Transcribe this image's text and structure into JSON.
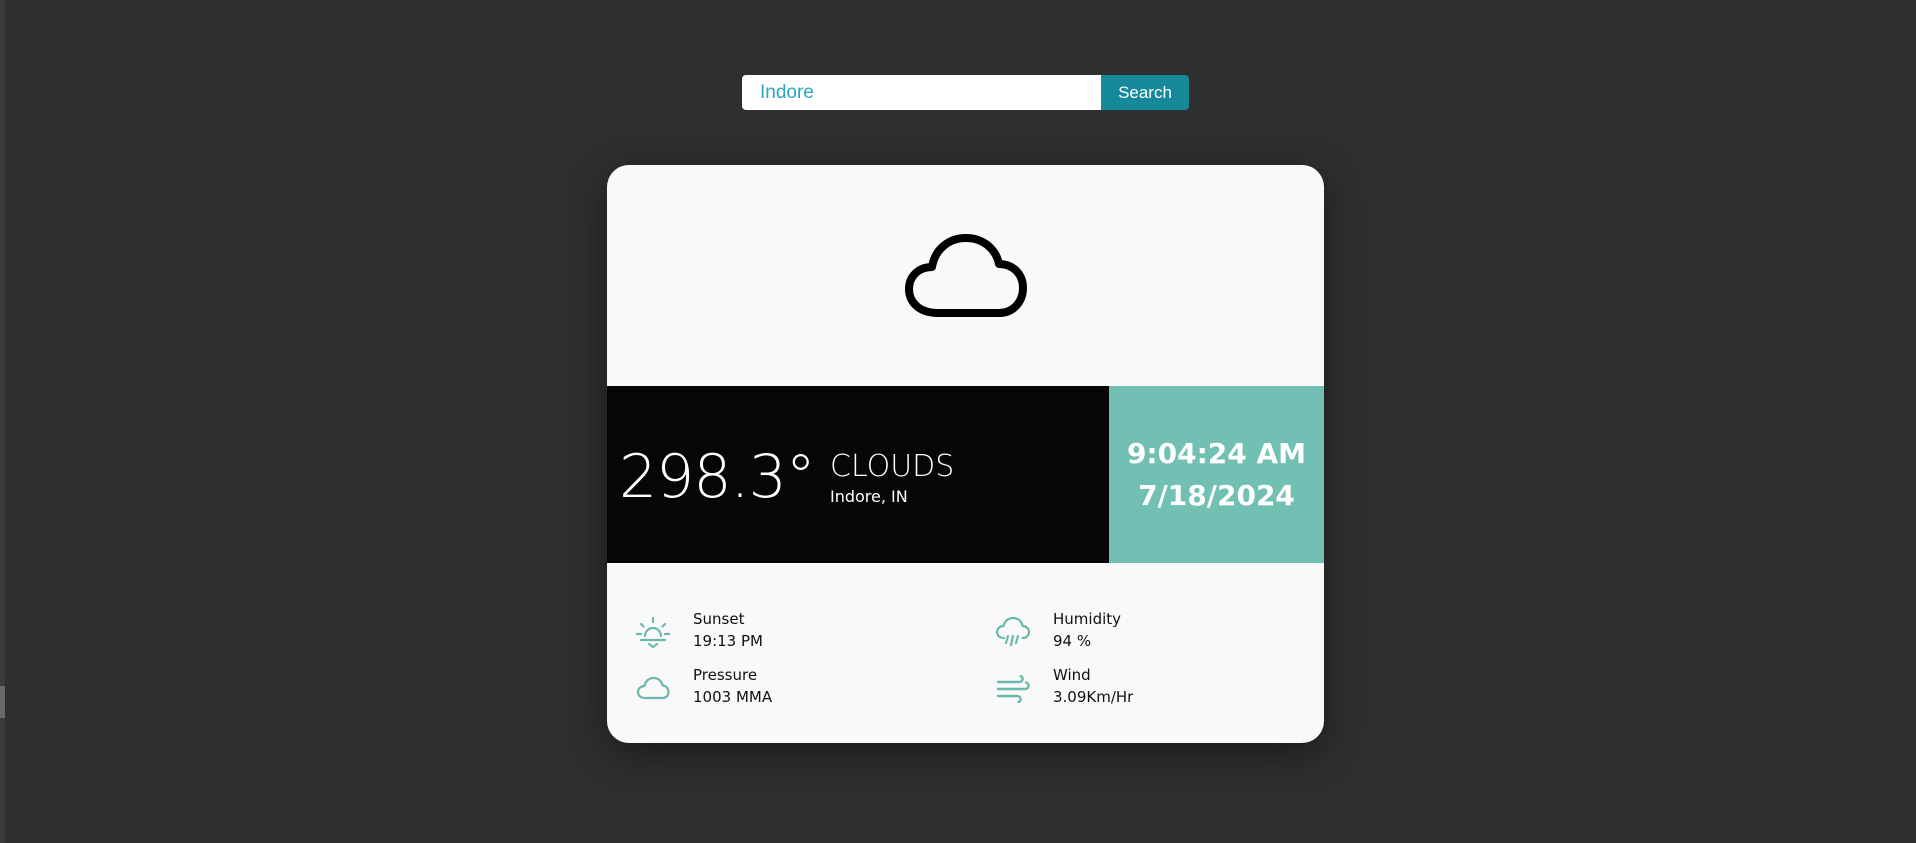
{
  "search": {
    "value": "Indore",
    "button_label": "Search"
  },
  "weather": {
    "icon": "cloud-icon",
    "temperature": "298.3°",
    "condition": "CLOUDS",
    "location": "Indore, IN",
    "time": "9:04:24 AM",
    "date": "7/18/2024"
  },
  "details": [
    {
      "label": "Sunset",
      "value": "19:13 PM",
      "icon": "sunset-icon"
    },
    {
      "label": "Humidity",
      "value": "94 %",
      "icon": "humidity-icon"
    },
    {
      "label": "Pressure",
      "value": "1003 MMA",
      "icon": "pressure-icon"
    },
    {
      "label": "Wind",
      "value": "3.09Km/Hr",
      "icon": "wind-icon"
    }
  ],
  "colors": {
    "background": "#2f2f2f",
    "card": "#f9f9f9",
    "dark_band": "#070605",
    "accent": "#72bfb3",
    "button": "#15889a",
    "input_text": "#2aa6c2",
    "icon": "#6ab9ad"
  }
}
